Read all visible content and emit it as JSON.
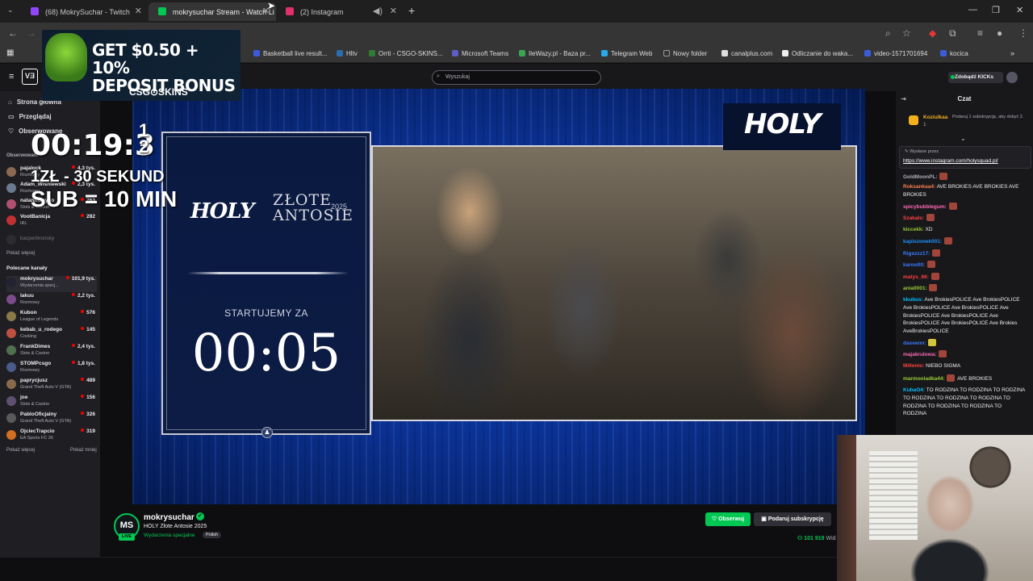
{
  "browser": {
    "tabs": [
      {
        "title": "(68) MokrySuchar - Twitch",
        "favicon_color": "#9146ff",
        "active": false
      },
      {
        "title": "mokrysuchar Stream - Watch Li",
        "favicon_color": "#00c853",
        "active": true
      },
      {
        "title": "(2) Instagram",
        "favicon_color": "#e1306c",
        "active": false
      }
    ],
    "bookmarks": [
      {
        "label": "Basketball live result...",
        "color": "#3b5bdb"
      },
      {
        "label": "Hltv",
        "color": "#2b6cb0"
      },
      {
        "label": "Orrti - CSGO-SKINS...",
        "color": "#2e7d32"
      },
      {
        "label": "Microsoft Teams",
        "color": "#5b5fc7"
      },
      {
        "label": "IleWazy.pl - Baza pr...",
        "color": "#3aa655"
      },
      {
        "label": "Telegram Web",
        "color": "#29a9eb"
      },
      {
        "label": "Nowy folder",
        "color": "#999999"
      },
      {
        "label": "canalplus.com",
        "color": "#dddddd"
      },
      {
        "label": "Odliczanie do waka...",
        "color": "#eeeeee"
      },
      {
        "label": "video-1571701694",
        "color": "#3b5bdb"
      },
      {
        "label": "kocica",
        "color": "#3b5bdb"
      }
    ]
  },
  "twitch": {
    "search_placeholder": "Wyszukaj",
    "kicks_label": "Zdobądź KICKs",
    "nav": [
      "Strona główna",
      "Przeglądaj",
      "Obserwowane"
    ],
    "followed_header": "Obserwowani",
    "followed": [
      {
        "name": "pajalock",
        "game": "Rozmowy",
        "viewers": "4,3 tys.",
        "color": "#8a6a52"
      },
      {
        "name": "Adam_Wisniewski",
        "game": "Rozmowy",
        "viewers": "2,3 tys.",
        "color": "#6b7a90"
      },
      {
        "name": "natanmanyoo",
        "game": "Slots & Casino",
        "viewers": "763",
        "color": "#b05070"
      },
      {
        "name": "VootBanicja",
        "game": "IRL",
        "viewers": "282",
        "color": "#c03030"
      },
      {
        "name": "kacperbronsky",
        "game": "",
        "viewers": "",
        "color": "#444444"
      }
    ],
    "show_more": "Pokaż więcej",
    "show_less": "Pokaż mniej",
    "recommended_header": "Polecane kanały",
    "recommended": [
      {
        "name": "mokrysuchar",
        "game": "Wydarzenia specj...",
        "viewers": "101,9 tys.",
        "color": "#222233"
      },
      {
        "name": "lakuu",
        "game": "Rozmowy",
        "viewers": "2,2 tys.",
        "color": "#7a4a8a"
      },
      {
        "name": "Kubon",
        "game": "League of Legends",
        "viewers": "576",
        "color": "#8a7a4a"
      },
      {
        "name": "kebab_u_rodego",
        "game": "Cooking",
        "viewers": "145",
        "color": "#c05040"
      },
      {
        "name": "FrankDimes",
        "game": "Slots & Casino",
        "viewers": "2,4 tys.",
        "color": "#507050"
      },
      {
        "name": "STOMPcsgo",
        "game": "Rozmowy",
        "viewers": "1,8 tys.",
        "color": "#4a5a8a"
      },
      {
        "name": "paprycjusz",
        "game": "Grand Theft Auto V (GTA)",
        "viewers": "489",
        "color": "#8a6a4a"
      },
      {
        "name": "joe",
        "game": "Slots & Casino",
        "viewers": "156",
        "color": "#605070"
      },
      {
        "name": "PabloOficjalny",
        "game": "Grand Theft Auto V (GTA)",
        "viewers": "326",
        "color": "#5a5a5a"
      },
      {
        "name": "OjciecTrapcio",
        "game": "EA Sports FC 26",
        "viewers": "319",
        "color": "#d07020"
      }
    ]
  },
  "stream": {
    "countdown_label": "STARTUJEMY ZA",
    "countdown": "00:05",
    "holy": "HOLY",
    "event_title_1": "ZŁOTE",
    "event_title_2": "ANTOSIE",
    "event_year": "2025",
    "overlay_timer": "00:19:3",
    "overlay_timer_sup": "1\n2",
    "overlay_line1": "1ZŁ - 30 SEKUND",
    "overlay_line2": "SUB = 10 MIN",
    "ad_headline": "GET $0.50 + 10%\nDEPOSIT BONUS",
    "ad_brand": "CSG⊙SKINS"
  },
  "channel": {
    "avatar_initials": "MS",
    "live_label": "LIVE",
    "name": "mokrysuchar",
    "title": "HOLY Złote Antosie 2025",
    "category": "Wydarzenia specjalne",
    "language": "Polish",
    "follow_label": "Obserwuj",
    "subscribe_label": "Podaruj subskrypcję",
    "viewers": "101 919",
    "viewers_suffix": "Wid"
  },
  "chat": {
    "title": "Czat",
    "gift": {
      "user": "Koziulkaa",
      "sub": "1",
      "text": "Podaruj 1 subskrypcję, aby dobyć 2."
    },
    "pinned_header": "Wysłane przez",
    "pinned_link": "https://www.instagram.com/holysquad.pl/",
    "messages": [
      {
        "user": "GoldMoonPL:",
        "color": "#adadb8",
        "text": "",
        "emotes": 1
      },
      {
        "user": "Roksankaa4:",
        "color": "#ff7f50",
        "text": "AVE BROKIES AVE BROKIES AVE BROKIES",
        "emotes": 0
      },
      {
        "user": "spicybubblegum:",
        "color": "#ff69b4",
        "text": "",
        "emotes": 1
      },
      {
        "user": "Szakals:",
        "color": "#ff4040",
        "text": "",
        "emotes": 1
      },
      {
        "user": "kiccekk:",
        "color": "#9acd32",
        "text": "XD",
        "emotes": 0
      },
      {
        "user": "kapiszonek001:",
        "color": "#1e90ff",
        "text": "",
        "emotes": 1
      },
      {
        "user": "Rigezzz17:",
        "color": "#3a7bff",
        "text": "",
        "emotes": 1
      },
      {
        "user": "karoo00:",
        "color": "#3a7bff",
        "text": "",
        "emotes": 1
      },
      {
        "user": "matys_86:",
        "color": "#ff4040",
        "text": "",
        "emotes": 1
      },
      {
        "user": "ania0001:",
        "color": "#9acd32",
        "text": "",
        "emotes": 1
      },
      {
        "user": "kkubus:",
        "color": "#00bfff",
        "text": "Ave BrokiesPOLICE Ave BrokiesPOLICE Ave BrokiesPOLICE Ave BrokiesPOLICE Ave BrokiesPOLICE Ave BrokiesPOLICE Ave BrokiesPOLICE Ave BrokiesPOLICE Ave Brokies AveBrokiesPOLICE",
        "emotes": 0
      },
      {
        "user": "daxeenn:",
        "color": "#3a7bff",
        "text": "",
        "emotes": 1
      },
      {
        "user": "majakrulowa:",
        "color": "#ff69b4",
        "text": "",
        "emotes": 1
      },
      {
        "user": "Millenio:",
        "color": "#ff4040",
        "text": "NIEBO SIGMA",
        "emotes": 0
      },
      {
        "user": "marmooladka44:",
        "color": "#9acd32",
        "text": "AVE BROKIES",
        "emotes": 1
      },
      {
        "user": "KubaO4:",
        "color": "#00bfff",
        "text": "TO RODZINA TO RODZINA TO RODZINA TO RODZINA TO RODZINA TO RODZINA TO RODZINA TO RODZINA TO RODZINA TO RODZINA",
        "emotes": 0
      }
    ]
  },
  "colors": {
    "twitch_green": "#00c853",
    "video_blue": "#0a46c8",
    "chat_bg": "#18181b"
  }
}
